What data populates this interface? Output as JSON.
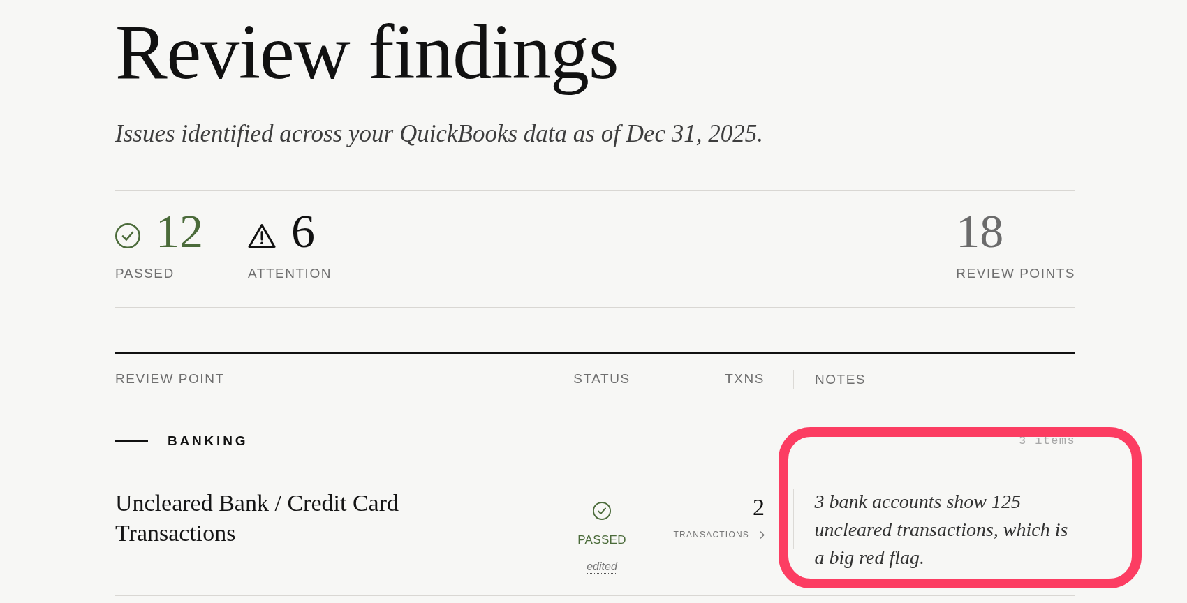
{
  "page": {
    "title": "Review findings",
    "subtitle": "Issues identified across your QuickBooks data as of Dec 31, 2025."
  },
  "summary": [
    {
      "kind": "passed",
      "value": "12",
      "label": "PASSED"
    },
    {
      "kind": "attention",
      "value": "6",
      "label": "ATTENTION"
    },
    {
      "kind": "total",
      "value": "18",
      "label": "REVIEW POINTS"
    }
  ],
  "table": {
    "columns": [
      "REVIEW POINT",
      "STATUS",
      "TXNS",
      "NOTES"
    ],
    "sections": [
      {
        "name": "BANKING",
        "count": "3 items",
        "rows": [
          {
            "review_point": "Uncleared Bank / Credit Card Transactions",
            "status": {
              "kind": "passed",
              "label": "PASSED",
              "note": "edited"
            },
            "txns": "2",
            "txns_link": "TRANSACTIONS",
            "notes": "3 bank accounts show 125 uncleared transactions, which is a big red flag.",
            "notes_highlighted": true
          }
        ]
      }
    ]
  }
}
